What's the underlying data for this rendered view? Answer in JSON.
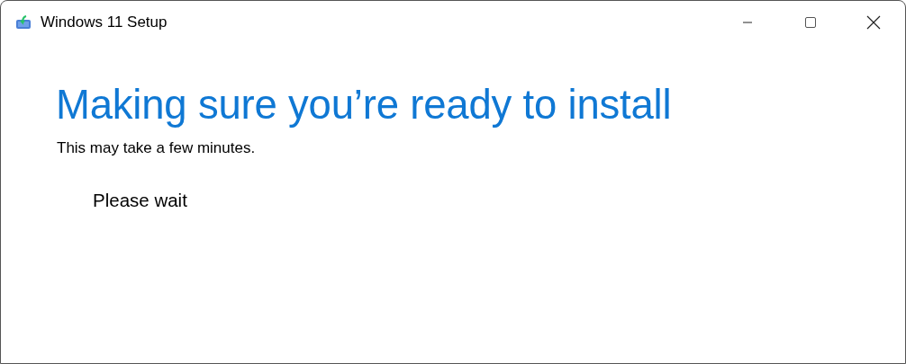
{
  "window": {
    "title": "Windows 11 Setup"
  },
  "heading": "Making sure you’re ready to install",
  "subtitle": "This may take a few minutes.",
  "status": "Please wait"
}
